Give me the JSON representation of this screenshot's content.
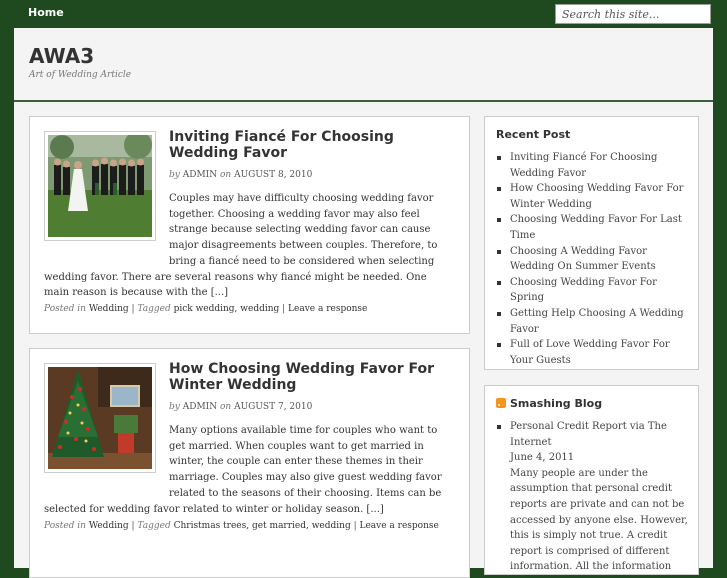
{
  "nav": {
    "home": "Home",
    "search_placeholder": "Search this site..."
  },
  "site": {
    "title": "AWA3",
    "description": "Art of Wedding Article"
  },
  "posts": [
    {
      "title": "Inviting Fiancé For Choosing Wedding Favor",
      "by": "by",
      "author": "ADMIN",
      "on": "on",
      "date": "AUGUST 8, 2010",
      "excerpt": "Couples may have difficulty choosing wedding favor together. Choosing a wedding favor may also feel strange because selecting wedding favor can cause major disagreements between couples. Therefore, to bring a fiancé need to be considered when selecting wedding favor. There are several reasons why fiancé might be needed. One main reason is because with the [...]",
      "posted_in": "Posted in",
      "category": "Wedding",
      "tagged": "Tagged",
      "tags": "pick wedding, wedding",
      "response": "Leave a response"
    },
    {
      "title": "How Choosing Wedding Favor For Winter Wedding",
      "by": "by",
      "author": "ADMIN",
      "on": "on",
      "date": "AUGUST 7, 2010",
      "excerpt": "Many options available time for couples who want to get married. When couples want to get married in winter, the couple can enter these themes in their marriage. Couples may also give guest wedding favor related to the seasons of their choosing. Items can be selected for wedding favor related to winter or holiday season. [...]",
      "posted_in": "Posted in",
      "category": "Wedding",
      "tagged": "Tagged",
      "tags": "Christmas trees, get married, wedding",
      "response": "Leave a response"
    }
  ],
  "sidebar": {
    "recent": {
      "title": "Recent Post",
      "items": [
        "Inviting Fiancé For Choosing Wedding Favor",
        "How Choosing Wedding Favor For Winter Wedding",
        "Choosing Wedding Favor For Last Time",
        "Choosing A Wedding Favor Wedding On Summer Events",
        "Choosing Wedding Favor For Spring",
        "Getting Help Choosing A Wedding Favor",
        "Full of Love Wedding Favor For Your Guests"
      ]
    },
    "smashing": {
      "title": "Smashing Blog",
      "item_title": "Personal Credit Report via The Internet",
      "item_date": "June 4, 2011",
      "item_text": "Many people are under the assumption that personal credit reports are private and can not be accessed by anyone else. However, this is simply not true. A credit report is comprised of different information. All the information"
    }
  },
  "colors": {
    "nav_bg": "#1f4a1f",
    "content_bg": "#f4f4f4",
    "accent_rule": "#3d5f3d"
  }
}
